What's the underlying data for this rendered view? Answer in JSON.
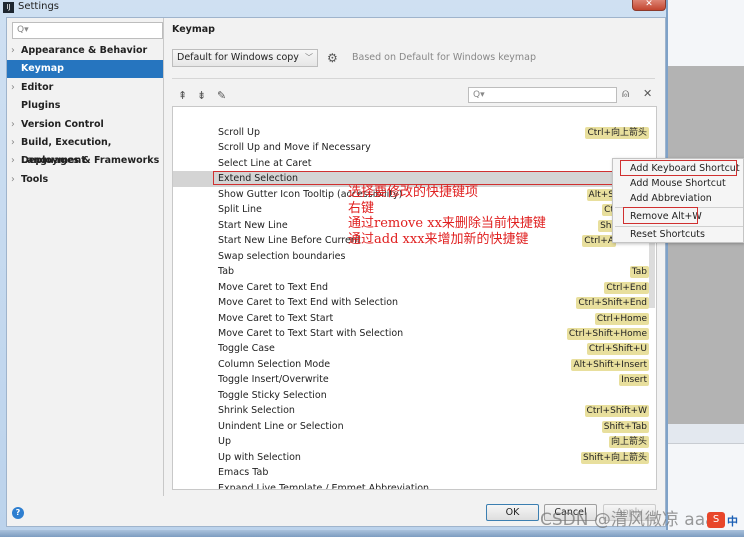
{
  "window": {
    "title": "Settings",
    "close_icon": "close-icon"
  },
  "sidebar": {
    "search_placeholder": "Q▾",
    "items": [
      {
        "label": "Appearance & Behavior",
        "expandable": true
      },
      {
        "label": "Keymap",
        "selected": true
      },
      {
        "label": "Editor",
        "expandable": true
      },
      {
        "label": "Plugins"
      },
      {
        "label": "Version Control",
        "expandable": true
      },
      {
        "label": "Build, Execution, Deployment",
        "expandable": true
      },
      {
        "label": "Languages & Frameworks",
        "expandable": true
      },
      {
        "label": "Tools",
        "expandable": true
      }
    ]
  },
  "panel": {
    "title": "Keymap",
    "keymap_value": "Default for Windows copy",
    "based_on": "Based on Default for Windows keymap",
    "filter_placeholder": "Q▾"
  },
  "actions": [
    {
      "name": "Scroll Up",
      "shortcut": "Ctrl+向上箭头"
    },
    {
      "name": "Scroll Up and Move if Necessary",
      "shortcut": ""
    },
    {
      "name": "Select Line at Caret",
      "shortcut": ""
    },
    {
      "name": "Extend Selection",
      "shortcut": "Alt+W",
      "selected": true
    },
    {
      "name": "Show Gutter Icon Tooltip (accessibility)",
      "shortcut": "Alt+S",
      "clipped": true
    },
    {
      "name": "Split Line",
      "shortcut": "Ct",
      "clipped": true
    },
    {
      "name": "Start New Line",
      "shortcut": "Shi",
      "clipped": true
    },
    {
      "name": "Start New Line Before Current",
      "shortcut": "Ctrl+A",
      "clipped": true
    },
    {
      "name": "Swap selection boundaries",
      "shortcut": ""
    },
    {
      "name": "Tab",
      "shortcut": "Tab"
    },
    {
      "name": "Move Caret to Text End",
      "shortcut": "Ctrl+End"
    },
    {
      "name": "Move Caret to Text End with Selection",
      "shortcut": "Ctrl+Shift+End"
    },
    {
      "name": "Move Caret to Text Start",
      "shortcut": "Ctrl+Home"
    },
    {
      "name": "Move Caret to Text Start with Selection",
      "shortcut": "Ctrl+Shift+Home"
    },
    {
      "name": "Toggle Case",
      "shortcut": "Ctrl+Shift+U"
    },
    {
      "name": "Column Selection Mode",
      "shortcut": "Alt+Shift+Insert"
    },
    {
      "name": "Toggle Insert/Overwrite",
      "shortcut": "Insert"
    },
    {
      "name": "Toggle Sticky Selection",
      "shortcut": ""
    },
    {
      "name": "Shrink Selection",
      "shortcut": "Ctrl+Shift+W"
    },
    {
      "name": "Unindent Line or Selection",
      "shortcut": "Shift+Tab"
    },
    {
      "name": "Up",
      "shortcut": "向上箭头"
    },
    {
      "name": "Up with Selection",
      "shortcut": "Shift+向上箭头"
    },
    {
      "name": "Emacs Tab",
      "shortcut": ""
    },
    {
      "name": "Expand Live Template / Emmet Abbreviation",
      "shortcut": ""
    },
    {
      "name": "Fill Paragraph",
      "shortcut": ""
    }
  ],
  "context_menu": {
    "items": [
      "Add Keyboard Shortcut",
      "Add Mouse Shortcut",
      "Add Abbreviation",
      "Remove Alt+W",
      "Reset Shortcuts"
    ]
  },
  "annotation": [
    "选择要修改的快捷键项",
    "右键",
    "通过remove xx来删除当前快捷键",
    "通过add xxx来增加新的快捷键"
  ],
  "buttons": {
    "ok": "OK",
    "cancel": "Cancel",
    "apply": "Apply",
    "help": "?"
  },
  "watermark": "CSDN @清风微凉 aaa",
  "ime": {
    "logo": "S",
    "label": "中"
  },
  "colors": {
    "selection": "#2675bf",
    "annotation": "#e02020",
    "shortcut_chip": "#e8df9d"
  }
}
